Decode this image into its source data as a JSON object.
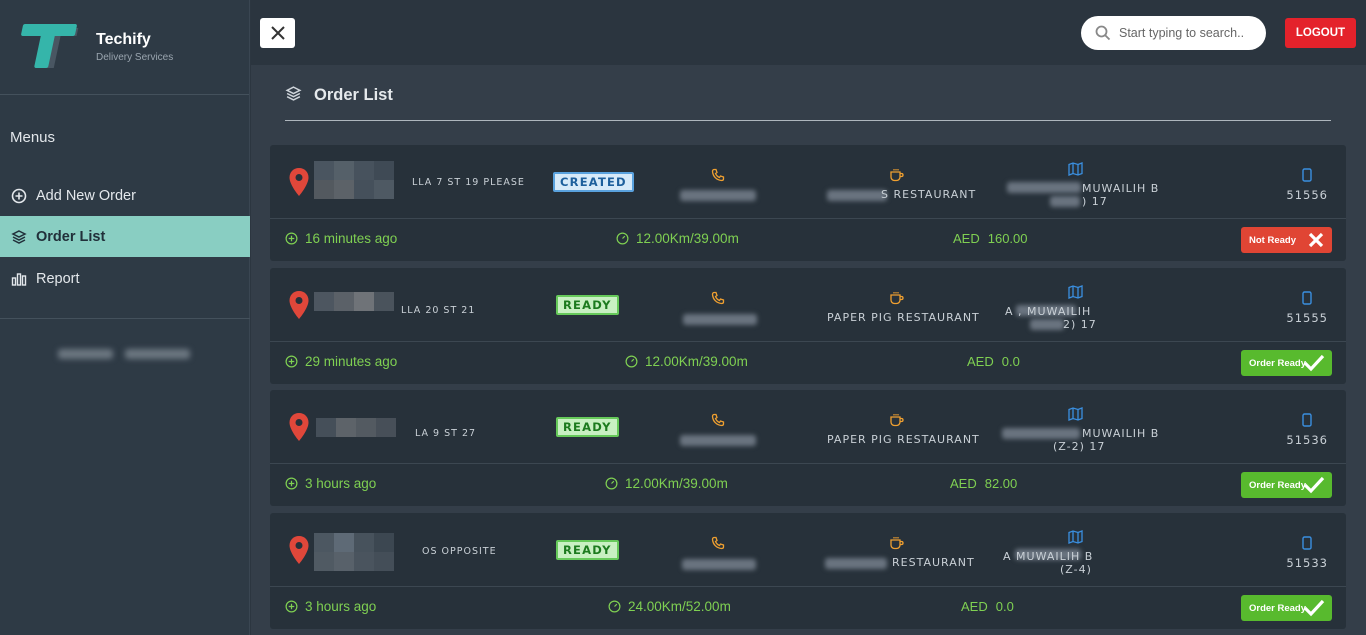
{
  "app": {
    "name": "Techify",
    "subtitle": "Delivery Services"
  },
  "sidebar": {
    "menus_title": "Menus",
    "items": [
      {
        "label": "Add New Order",
        "icon": "plus-circle-icon"
      },
      {
        "label": "Order List",
        "icon": "layers-icon",
        "active": true
      },
      {
        "label": "Report",
        "icon": "bar-chart-icon"
      }
    ]
  },
  "header": {
    "search_placeholder": "Start typing to search..",
    "logout_label": "LOGOUT"
  },
  "page": {
    "title": "Order List"
  },
  "orders": [
    {
      "address_tail": "LLA 7 ST 19 PLEASE",
      "status": "CREATED",
      "restaurant_tail": "S RESTAURANT",
      "location_line1": "MUWAILIH B",
      "location_line2": ") 17",
      "order_id": "51556",
      "time_ago": "16 minutes ago",
      "distance": "12.00Km/39.00m",
      "currency": "AED",
      "amount": "160.00",
      "action_label": "Not Ready"
    },
    {
      "address_tail": "LLA 20 ST 21",
      "status": "READY",
      "restaurant_tail": "PAPER PIG RESTAURANT",
      "location_line1": "A , MUWAILIH",
      "location_line2": "2) 17",
      "order_id": "51555",
      "time_ago": "29 minutes ago",
      "distance": "12.00Km/39.00m",
      "currency": "AED",
      "amount": "0.0",
      "action_label": "Order Ready"
    },
    {
      "address_tail": "LA 9 ST 27",
      "status": "READY",
      "restaurant_tail": "PAPER PIG RESTAURANT",
      "location_line1": "MUWAILIH B",
      "location_line2": "(Z-2) 17",
      "order_id": "51536",
      "time_ago": "3 hours ago",
      "distance": "12.00Km/39.00m",
      "currency": "AED",
      "amount": "82.00",
      "action_label": "Order Ready"
    },
    {
      "address_tail": "OS OPPOSITE",
      "status": "READY",
      "restaurant_tail": "RESTAURANT",
      "location_line1": "A MUWAILIH B",
      "location_line2": "(Z-4)",
      "order_id": "51533",
      "time_ago": "3 hours ago",
      "distance": "24.00Km/52.00m",
      "currency": "AED",
      "amount": "0.0",
      "action_label": "Order Ready"
    }
  ],
  "colors": {
    "accent_teal": "#35b5aa",
    "active_menu": "#89cec2",
    "green_text": "#7fd052",
    "orange_icon": "#f0a030",
    "blue_icon": "#3a8fe0",
    "logout_red": "#e4222b",
    "not_ready_red": "#e04534",
    "ready_green": "#58ba2e"
  }
}
